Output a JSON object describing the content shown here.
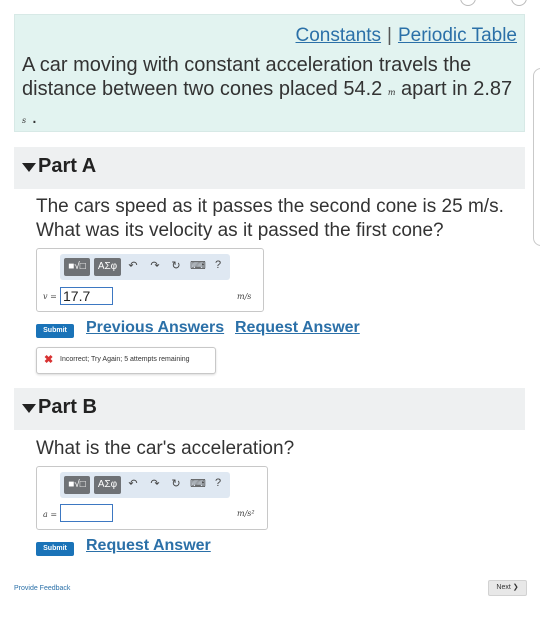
{
  "links": {
    "constants": "Constants",
    "separator": "|",
    "periodic_table": "Periodic Table"
  },
  "problem": {
    "text_before": "A car moving with constant acceleration travels the distance between two cones placed 54.2 ",
    "distance_unit": "m",
    "text_middle": " apart in 2.87",
    "time_unit": "s",
    "text_end": " ."
  },
  "part_a": {
    "title": "Part A",
    "question": "The cars speed as it passes the second cone is 25 m/s.  What was its velocity as it passed the first cone?",
    "toolbar": {
      "templates": "■√□",
      "symbols": "AΣφ",
      "undo": "↶",
      "redo": "↷",
      "reset": "↻",
      "keyboard": "⌨",
      "help": "?"
    },
    "var_label": "v =",
    "input_value": "17.7",
    "unit": "m/s",
    "submit": "Submit",
    "previous_answers": "Previous Answers",
    "request_answer": "Request Answer",
    "feedback": "Incorrect; Try Again; 5 attempts remaining"
  },
  "part_b": {
    "title": "Part B",
    "question": "What is the car's acceleration?",
    "toolbar": {
      "templates": "■√□",
      "symbols": "AΣφ",
      "undo": "↶",
      "redo": "↷",
      "reset": "↻",
      "keyboard": "⌨",
      "help": "?"
    },
    "var_label": "a =",
    "input_value": "",
    "unit": "m/s²",
    "submit": "Submit",
    "request_answer": "Request Answer"
  },
  "footer": {
    "provide_feedback": "Provide Feedback",
    "next": "Next ❯"
  },
  "colors": {
    "accent": "#2b70a8",
    "submit": "#1a73b8",
    "intro_bg": "#e2f3f0",
    "error": "#d83232"
  }
}
